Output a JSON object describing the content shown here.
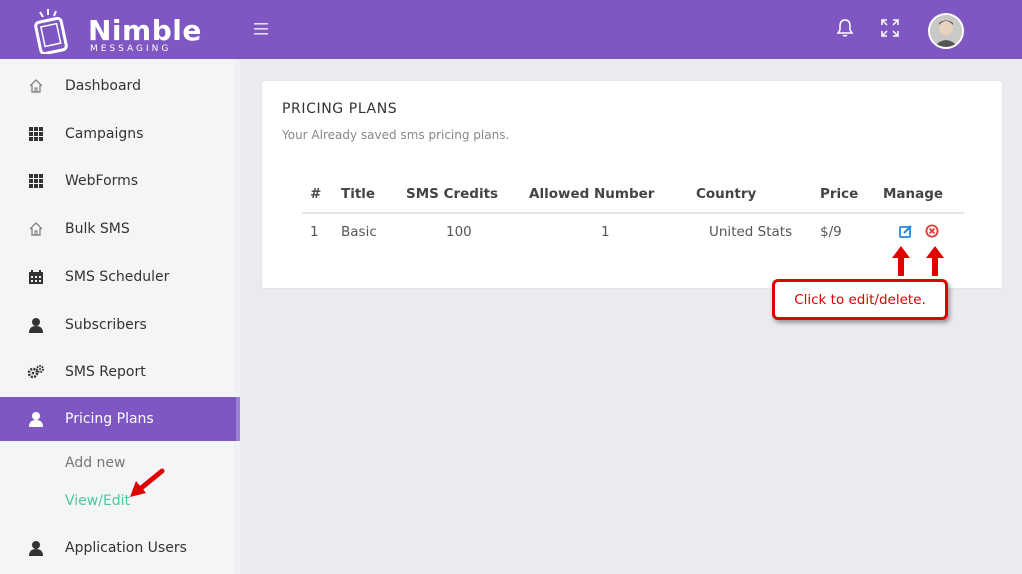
{
  "brand": {
    "name": "Nimble",
    "tagline": "MESSAGING"
  },
  "header": {
    "menu_icon": "hamburger-icon",
    "notification_icon": "bell-icon",
    "fullscreen_icon": "expand-icon",
    "avatar_icon": "user-avatar"
  },
  "sidebar": {
    "items": [
      {
        "label": "Dashboard",
        "icon": "home-icon"
      },
      {
        "label": "Campaigns",
        "icon": "grid-icon"
      },
      {
        "label": "WebForms",
        "icon": "grid-icon"
      },
      {
        "label": "Bulk SMS",
        "icon": "home-icon"
      },
      {
        "label": "SMS Scheduler",
        "icon": "calendar-icon"
      },
      {
        "label": "Subscribers",
        "icon": "user-icon"
      },
      {
        "label": "SMS Report",
        "icon": "gears-icon"
      },
      {
        "label": "Pricing Plans",
        "icon": "user-icon",
        "active": true
      },
      {
        "label": "Application Users",
        "icon": "user-icon"
      }
    ],
    "submenu": [
      {
        "label": "Add new"
      },
      {
        "label": "View/Edit",
        "active": true
      }
    ]
  },
  "card": {
    "title": "PRICING PLANS",
    "subtitle": "Your Already saved sms pricing plans."
  },
  "table": {
    "columns": [
      "#",
      "Title",
      "SMS Credits",
      "Allowed Number",
      "Country",
      "Price",
      "Manage"
    ],
    "rows": [
      {
        "num": "1",
        "title": "Basic",
        "sms_credits": "100",
        "allowed_number": "1",
        "country": "United Stats",
        "price": "$/9"
      }
    ]
  },
  "annotation": {
    "callout_text": "Click to edit/delete."
  },
  "colors": {
    "brand": "#7e57c2",
    "accent_green": "#4ec6a0",
    "edit": "#1e88e5",
    "delete": "#e53935",
    "callout": "#e00000"
  }
}
